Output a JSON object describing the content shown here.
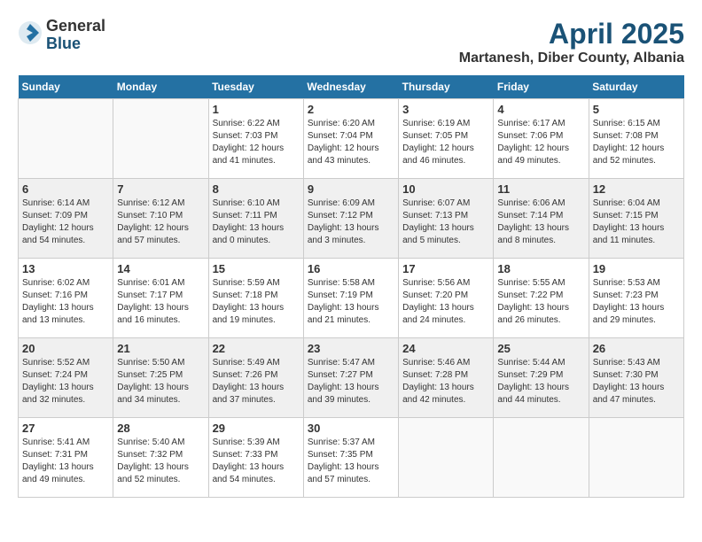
{
  "logo": {
    "general": "General",
    "blue": "Blue"
  },
  "header": {
    "month": "April 2025",
    "location": "Martanesh, Diber County, Albania"
  },
  "weekdays": [
    "Sunday",
    "Monday",
    "Tuesday",
    "Wednesday",
    "Thursday",
    "Friday",
    "Saturday"
  ],
  "weeks": [
    [
      {
        "day": "",
        "info": ""
      },
      {
        "day": "",
        "info": ""
      },
      {
        "day": "1",
        "info": "Sunrise: 6:22 AM\nSunset: 7:03 PM\nDaylight: 12 hours and 41 minutes."
      },
      {
        "day": "2",
        "info": "Sunrise: 6:20 AM\nSunset: 7:04 PM\nDaylight: 12 hours and 43 minutes."
      },
      {
        "day": "3",
        "info": "Sunrise: 6:19 AM\nSunset: 7:05 PM\nDaylight: 12 hours and 46 minutes."
      },
      {
        "day": "4",
        "info": "Sunrise: 6:17 AM\nSunset: 7:06 PM\nDaylight: 12 hours and 49 minutes."
      },
      {
        "day": "5",
        "info": "Sunrise: 6:15 AM\nSunset: 7:08 PM\nDaylight: 12 hours and 52 minutes."
      }
    ],
    [
      {
        "day": "6",
        "info": "Sunrise: 6:14 AM\nSunset: 7:09 PM\nDaylight: 12 hours and 54 minutes."
      },
      {
        "day": "7",
        "info": "Sunrise: 6:12 AM\nSunset: 7:10 PM\nDaylight: 12 hours and 57 minutes."
      },
      {
        "day": "8",
        "info": "Sunrise: 6:10 AM\nSunset: 7:11 PM\nDaylight: 13 hours and 0 minutes."
      },
      {
        "day": "9",
        "info": "Sunrise: 6:09 AM\nSunset: 7:12 PM\nDaylight: 13 hours and 3 minutes."
      },
      {
        "day": "10",
        "info": "Sunrise: 6:07 AM\nSunset: 7:13 PM\nDaylight: 13 hours and 5 minutes."
      },
      {
        "day": "11",
        "info": "Sunrise: 6:06 AM\nSunset: 7:14 PM\nDaylight: 13 hours and 8 minutes."
      },
      {
        "day": "12",
        "info": "Sunrise: 6:04 AM\nSunset: 7:15 PM\nDaylight: 13 hours and 11 minutes."
      }
    ],
    [
      {
        "day": "13",
        "info": "Sunrise: 6:02 AM\nSunset: 7:16 PM\nDaylight: 13 hours and 13 minutes."
      },
      {
        "day": "14",
        "info": "Sunrise: 6:01 AM\nSunset: 7:17 PM\nDaylight: 13 hours and 16 minutes."
      },
      {
        "day": "15",
        "info": "Sunrise: 5:59 AM\nSunset: 7:18 PM\nDaylight: 13 hours and 19 minutes."
      },
      {
        "day": "16",
        "info": "Sunrise: 5:58 AM\nSunset: 7:19 PM\nDaylight: 13 hours and 21 minutes."
      },
      {
        "day": "17",
        "info": "Sunrise: 5:56 AM\nSunset: 7:20 PM\nDaylight: 13 hours and 24 minutes."
      },
      {
        "day": "18",
        "info": "Sunrise: 5:55 AM\nSunset: 7:22 PM\nDaylight: 13 hours and 26 minutes."
      },
      {
        "day": "19",
        "info": "Sunrise: 5:53 AM\nSunset: 7:23 PM\nDaylight: 13 hours and 29 minutes."
      }
    ],
    [
      {
        "day": "20",
        "info": "Sunrise: 5:52 AM\nSunset: 7:24 PM\nDaylight: 13 hours and 32 minutes."
      },
      {
        "day": "21",
        "info": "Sunrise: 5:50 AM\nSunset: 7:25 PM\nDaylight: 13 hours and 34 minutes."
      },
      {
        "day": "22",
        "info": "Sunrise: 5:49 AM\nSunset: 7:26 PM\nDaylight: 13 hours and 37 minutes."
      },
      {
        "day": "23",
        "info": "Sunrise: 5:47 AM\nSunset: 7:27 PM\nDaylight: 13 hours and 39 minutes."
      },
      {
        "day": "24",
        "info": "Sunrise: 5:46 AM\nSunset: 7:28 PM\nDaylight: 13 hours and 42 minutes."
      },
      {
        "day": "25",
        "info": "Sunrise: 5:44 AM\nSunset: 7:29 PM\nDaylight: 13 hours and 44 minutes."
      },
      {
        "day": "26",
        "info": "Sunrise: 5:43 AM\nSunset: 7:30 PM\nDaylight: 13 hours and 47 minutes."
      }
    ],
    [
      {
        "day": "27",
        "info": "Sunrise: 5:41 AM\nSunset: 7:31 PM\nDaylight: 13 hours and 49 minutes."
      },
      {
        "day": "28",
        "info": "Sunrise: 5:40 AM\nSunset: 7:32 PM\nDaylight: 13 hours and 52 minutes."
      },
      {
        "day": "29",
        "info": "Sunrise: 5:39 AM\nSunset: 7:33 PM\nDaylight: 13 hours and 54 minutes."
      },
      {
        "day": "30",
        "info": "Sunrise: 5:37 AM\nSunset: 7:35 PM\nDaylight: 13 hours and 57 minutes."
      },
      {
        "day": "",
        "info": ""
      },
      {
        "day": "",
        "info": ""
      },
      {
        "day": "",
        "info": ""
      }
    ]
  ]
}
